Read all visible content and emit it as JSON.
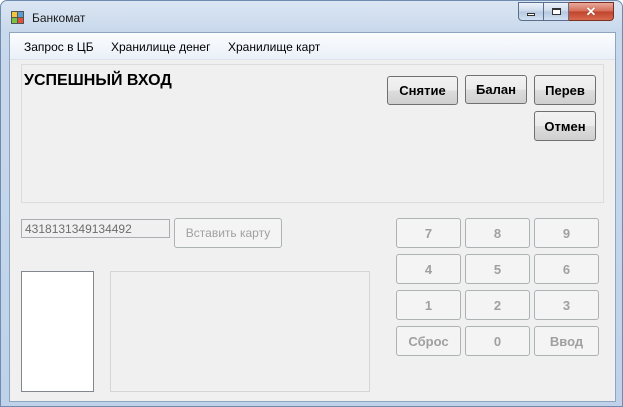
{
  "window": {
    "title": "Банкомат",
    "controls": {
      "minimize": "minimize-icon",
      "maximize": "maximize-icon",
      "close": "close-icon"
    }
  },
  "menu": {
    "items": [
      "Запрос в ЦБ",
      "Хранилище денег",
      "Хранилище карт"
    ]
  },
  "status": {
    "text": "УСПЕШНЫЙ ВХОД"
  },
  "actions": {
    "withdraw": "Снятие",
    "balance": "Балан",
    "transfer": "Перев",
    "cancel": "Отмен"
  },
  "card": {
    "number": "4318131349134492",
    "insert_label": "Вставить карту"
  },
  "keypad": {
    "keys": [
      "7",
      "8",
      "9",
      "4",
      "5",
      "6",
      "1",
      "2",
      "3",
      "Сброс",
      "0",
      "Ввод"
    ],
    "enabled": false
  },
  "colors": {
    "close_button": "#c9452f",
    "disabled_text": "#a0a0a0",
    "form_background": "#f0f0f0"
  }
}
